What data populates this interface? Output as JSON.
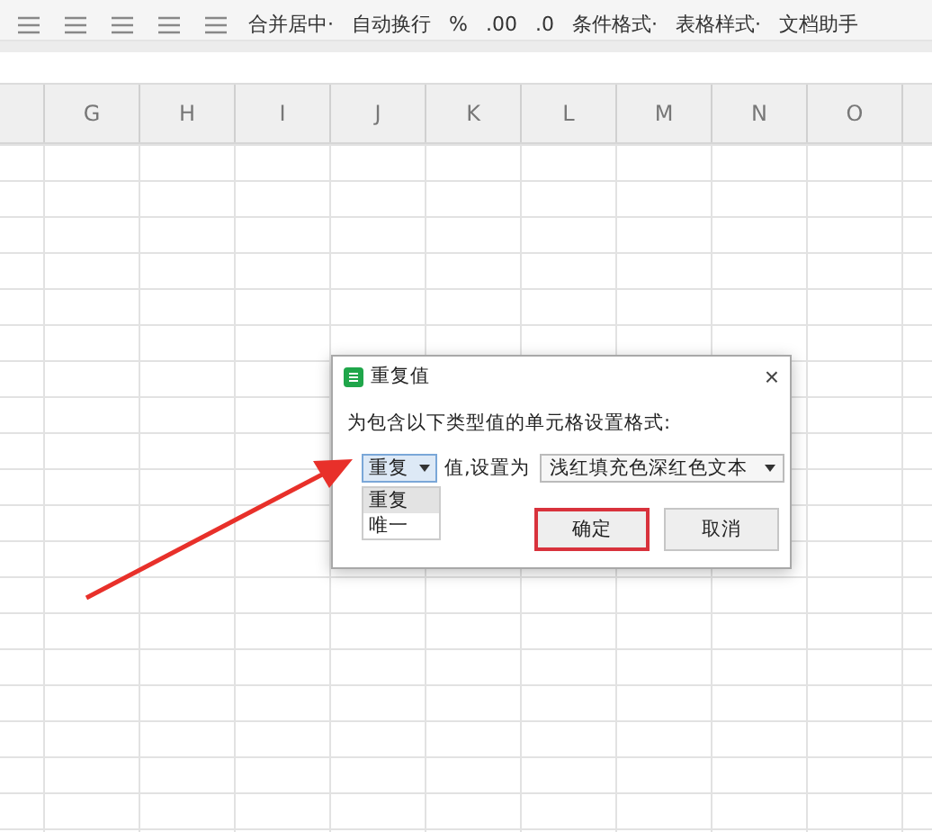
{
  "toolbar": {
    "items": [
      {
        "label": "合并居中·"
      },
      {
        "label": "自动换行"
      },
      {
        "label": "%"
      },
      {
        "label": ".00"
      },
      {
        "label": ".0"
      },
      {
        "label": "条件格式·"
      },
      {
        "label": "表格样式·"
      },
      {
        "label": "文档助手"
      }
    ]
  },
  "sheet": {
    "columns": [
      "G",
      "H",
      "I",
      "J",
      "K",
      "L",
      "M",
      "N",
      "O"
    ]
  },
  "dialog": {
    "title": "重复值",
    "close": "×",
    "prompt": "为包含以下类型值的单元格设置格式:",
    "type_select": {
      "value": "重复",
      "expanded": true,
      "options": [
        {
          "label": "重复",
          "selected": true
        },
        {
          "label": "唯一",
          "selected": false
        }
      ]
    },
    "mid_label": "值,设置为",
    "format_select": {
      "value": "浅红填充色深红色文本"
    },
    "buttons": [
      {
        "label": "确定",
        "focused": true
      },
      {
        "label": "取消",
        "focused": false
      }
    ]
  }
}
